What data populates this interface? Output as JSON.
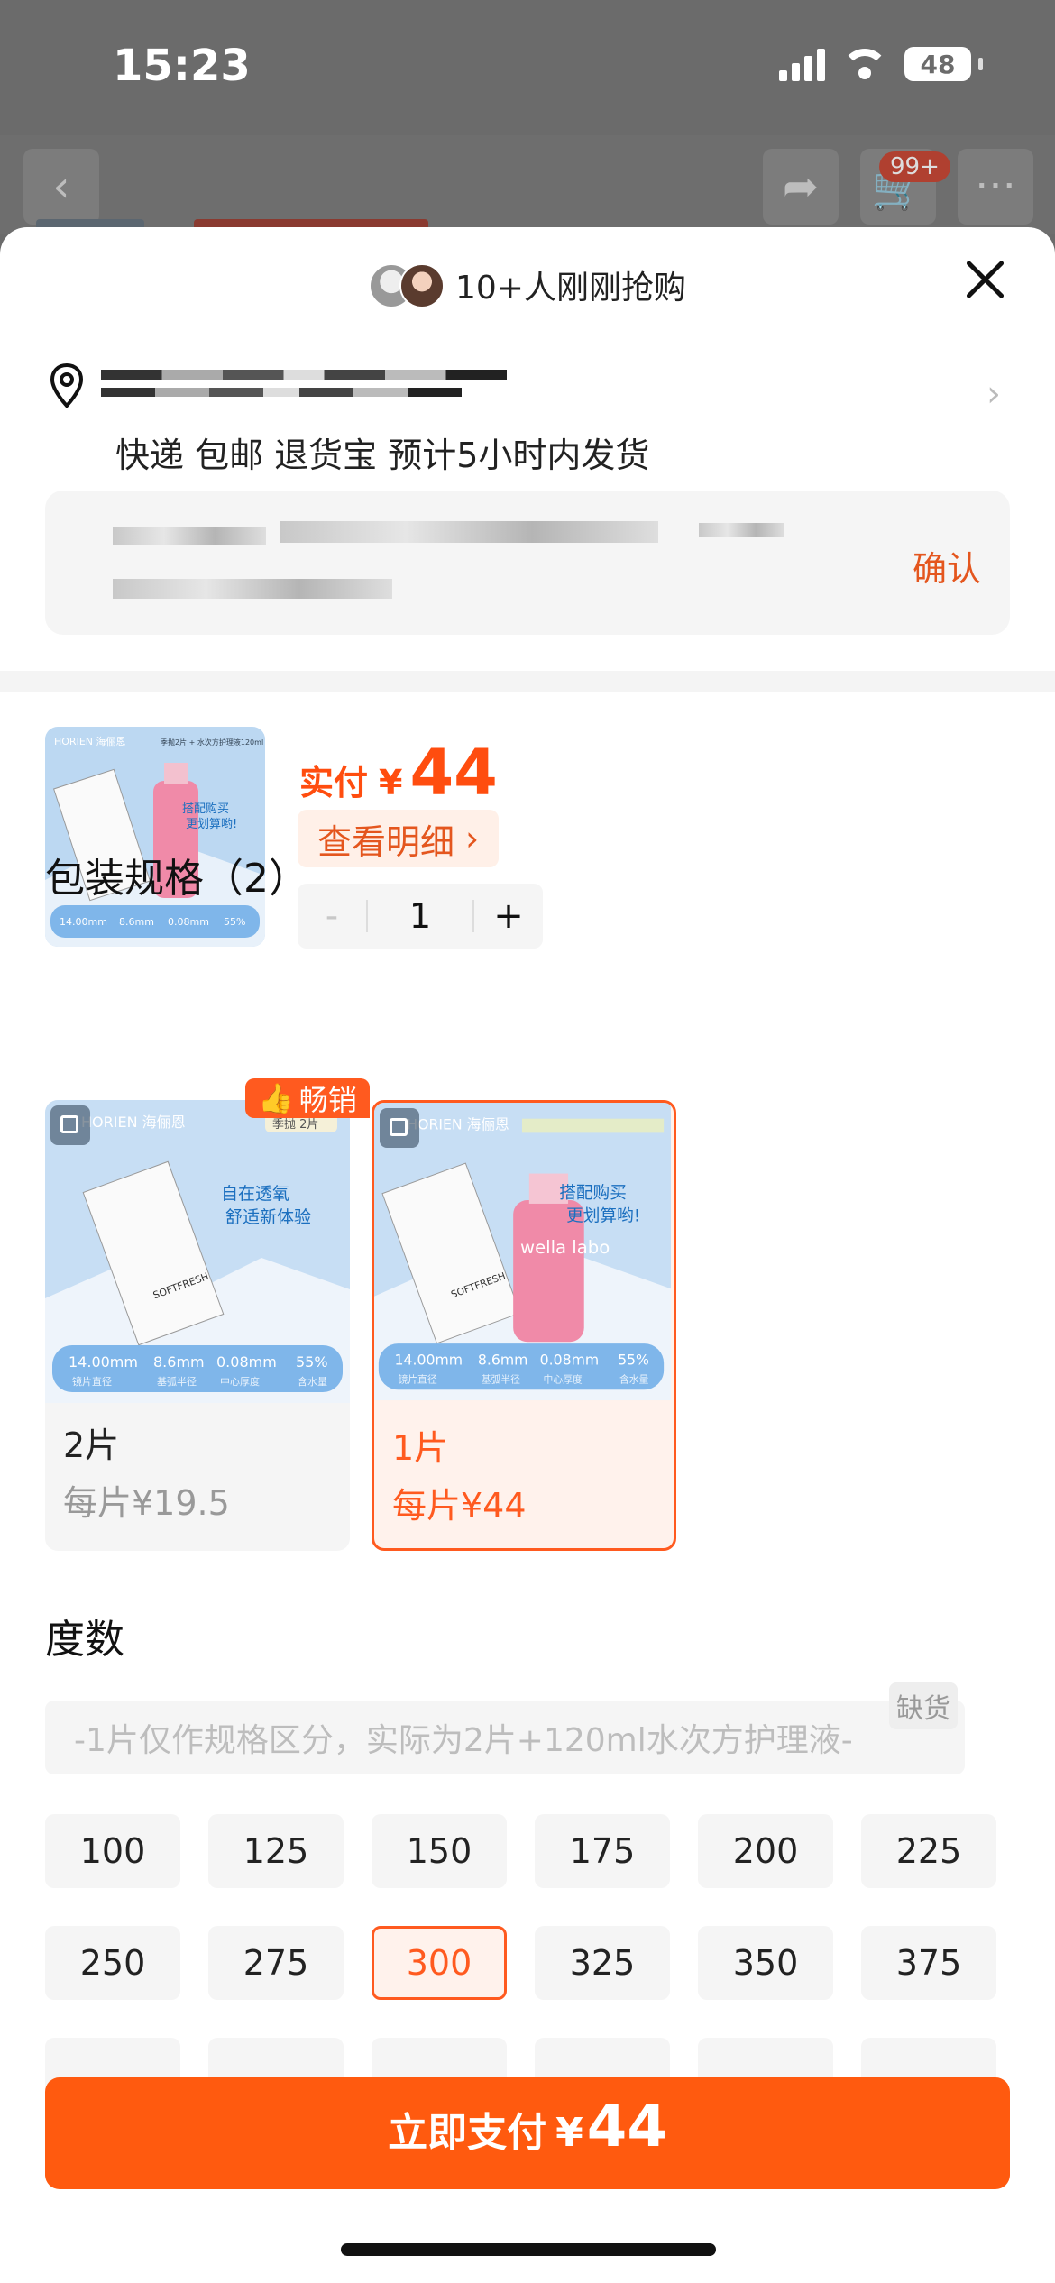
{
  "status_bar": {
    "time": "15:23",
    "battery": "48"
  },
  "background": {
    "cart_badge": "99+"
  },
  "sheet": {
    "buyers_text": "10+人刚刚抢购",
    "shipping_info": "快递 包邮 退货宝 预计5小时内发货",
    "confirm_label": "确认"
  },
  "product": {
    "paid_label": "实付",
    "currency": "¥",
    "paid_amount": "44",
    "detail_button": "查看明细",
    "detail_chevron": "›",
    "minus": "-",
    "quantity": "1",
    "plus": "+"
  },
  "package": {
    "title": "包装规格（2）",
    "hot_badge": "畅销",
    "options": [
      {
        "name": "2片",
        "price": "每片¥19.5",
        "selected": false,
        "img_tag": "季抛 2片"
      },
      {
        "name": "1片",
        "price": "每片¥44",
        "selected": true,
        "img_tag": ""
      }
    ],
    "thumb_texts": {
      "brand": "HORIEN 海俪恩",
      "promo_a": [
        "自在透氧",
        "舒适新体验"
      ],
      "promo_b": [
        "搭配购买",
        "更划算哟!"
      ],
      "box_label": "SOFTFRESH",
      "bottle_label": "wella labo",
      "specs": [
        "14.00mm",
        "8.6mm",
        "0.08mm",
        "55%"
      ],
      "spec_labels": [
        "镜片直径",
        "基弧半径",
        "中心厚度",
        "含水量"
      ],
      "top_banner": "季抛2片 + 水次方护理液120ml"
    }
  },
  "power": {
    "title": "度数",
    "note": "-1片仅作规格区分，实际为2片+120ml水次方护理液-",
    "note_tag": "缺货",
    "values": [
      "100",
      "125",
      "150",
      "175",
      "200",
      "225",
      "250",
      "275",
      "300",
      "325",
      "350",
      "375"
    ],
    "selected": "300"
  },
  "footer": {
    "pay_label": "立即支付",
    "currency": "¥",
    "amount": "44"
  },
  "colors": {
    "accent": "#ff5a0f",
    "accent_text": "#e4561e",
    "selected_bg": "#fff2ec"
  }
}
